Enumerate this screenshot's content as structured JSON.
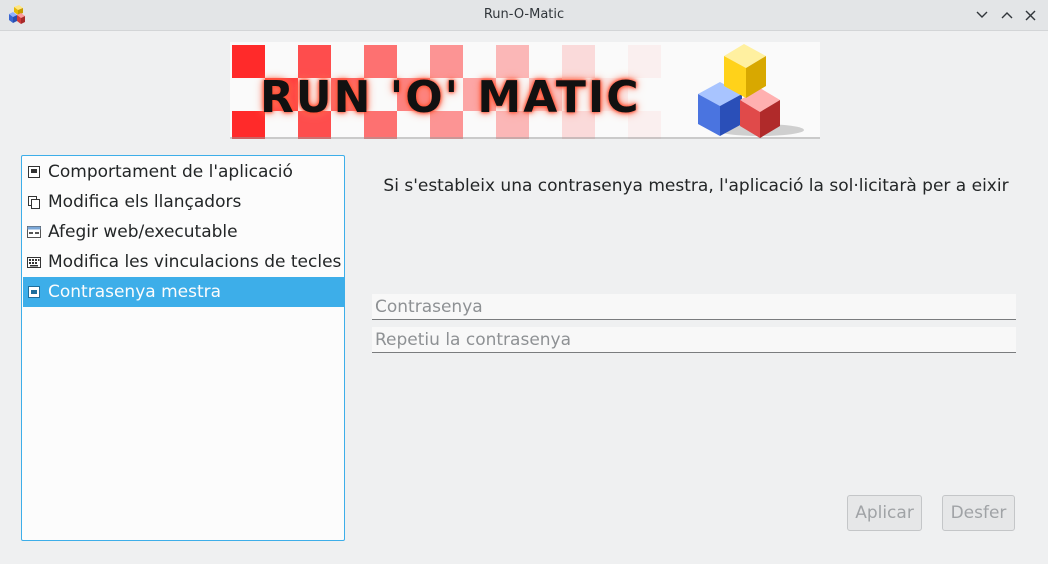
{
  "window": {
    "title": "Run-O-Matic",
    "controls": [
      "minimize",
      "maximize",
      "close"
    ]
  },
  "banner": {
    "text": "RUN 'O' MATIC",
    "colors": {
      "checker": "#ff2a2a",
      "glow": "#ff5a3c"
    }
  },
  "sidebar": {
    "items": [
      {
        "label": "Comportament de l'aplicació",
        "icon": "window-icon",
        "selected": false
      },
      {
        "label": "Modifica els llançadors",
        "icon": "copy-icon",
        "selected": false
      },
      {
        "label": "Afegir web/executable",
        "icon": "web-window-icon",
        "selected": false
      },
      {
        "label": "Modifica les vinculacions de tecles",
        "icon": "keyboard-icon",
        "selected": false
      },
      {
        "label": "Contrasenya mestra",
        "icon": "password-window-icon",
        "selected": true
      }
    ]
  },
  "main": {
    "info": "Si s'estableix una contrasenya mestra, l'aplicació la sol·licitarà per a eixir",
    "password_placeholder": "Contrasenya",
    "repeat_placeholder": "Repetiu la contrasenya",
    "password_value": "",
    "repeat_value": ""
  },
  "buttons": {
    "apply": "Aplicar",
    "undo": "Desfer"
  },
  "colors": {
    "accent": "#3daee9",
    "background": "#eff0f1"
  }
}
